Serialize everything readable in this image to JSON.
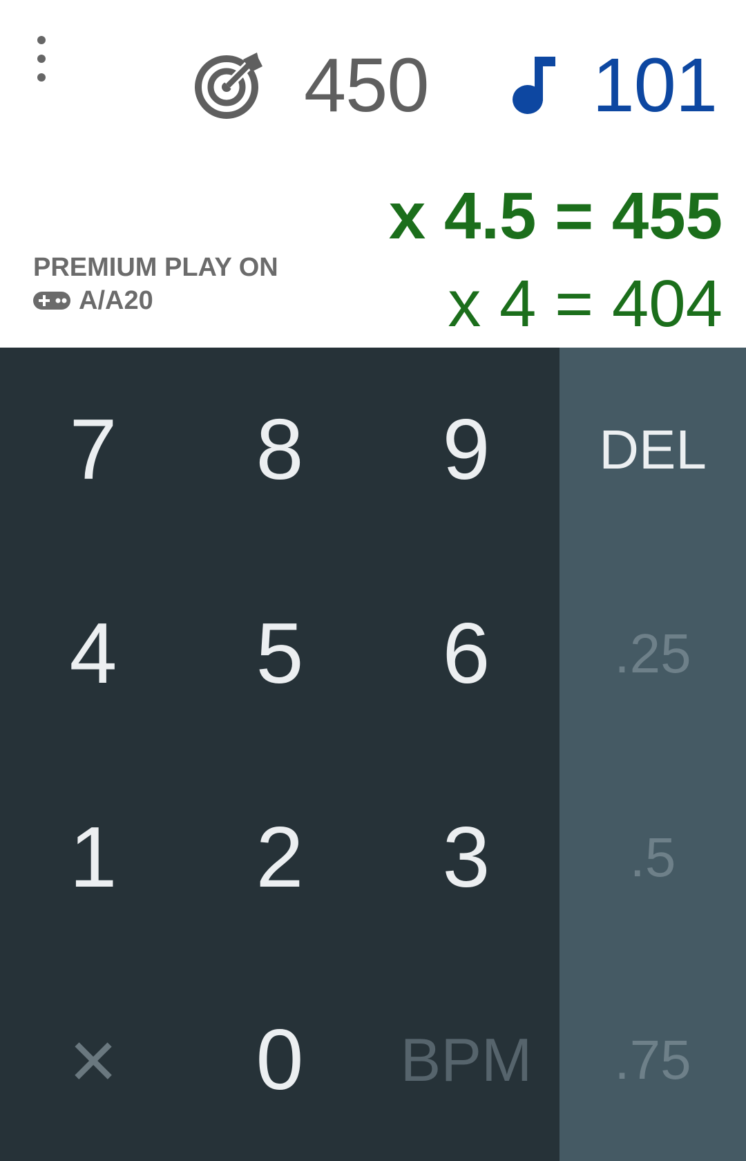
{
  "header": {
    "target_value": "450",
    "bpm_value": "101",
    "calc_primary": "x 4.5 = 455",
    "calc_secondary": "x 4 = 404",
    "premium_label": "PREMIUM PLAY ON",
    "device_label": "A/A20",
    "icons": {
      "menu": "more-vert-icon",
      "target": "target-icon",
      "note": "music-note-icon",
      "device": "gamepad-icon"
    },
    "colors": {
      "target": "#5f5f5f",
      "bpm": "#0d47a1",
      "calc": "#1b6e1b",
      "label": "#6b6b6b"
    }
  },
  "keypad": {
    "keys": {
      "k7": "7",
      "k8": "8",
      "k9": "9",
      "k4": "4",
      "k5": "5",
      "k6": "6",
      "k1": "1",
      "k2": "2",
      "k3": "3",
      "clear": "×",
      "k0": "0",
      "bpm": "BPM"
    },
    "side": {
      "del": "DEL",
      "q25": ".25",
      "q5": ".5",
      "q75": ".75"
    },
    "colors": {
      "pad_bg": "#263238",
      "side_bg": "#455a64",
      "key_text": "#eceff1"
    }
  }
}
